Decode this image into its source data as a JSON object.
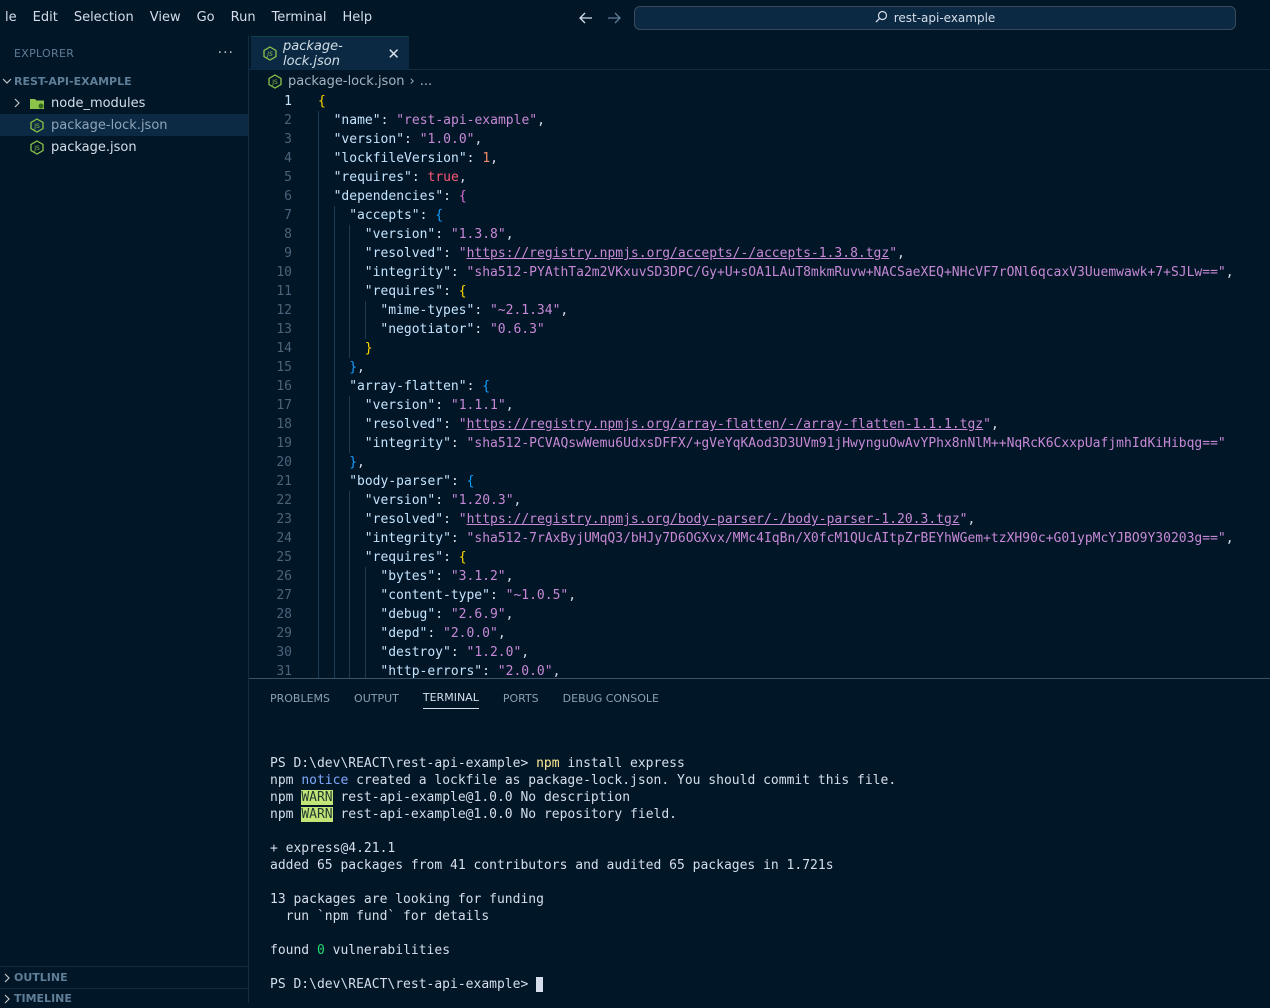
{
  "menu": [
    "le",
    "Edit",
    "Selection",
    "View",
    "Go",
    "Run",
    "Terminal",
    "Help"
  ],
  "search": {
    "label": "rest-api-example"
  },
  "sidebar": {
    "explorer_title": "EXPLORER",
    "explorer_more": "···",
    "project": "REST-API-EXAMPLE",
    "items": [
      {
        "label": "node_modules",
        "icon": "folder-icon"
      },
      {
        "label": "package-lock.json",
        "icon": "nodejs-icon"
      },
      {
        "label": "package.json",
        "icon": "nodejs-icon"
      }
    ],
    "outline": "OUTLINE",
    "timeline": "TIMELINE"
  },
  "tab": {
    "label": "package-lock.json",
    "close": "✕"
  },
  "breadcrumb": {
    "file": "package-lock.json",
    "sep": "›",
    "rest": "..."
  },
  "editor_lines": [
    [
      [
        "br1",
        "{"
      ]
    ],
    [
      [
        "k",
        "\"name\""
      ],
      [
        "p",
        ": "
      ],
      [
        "s",
        "\"rest-api-example\""
      ],
      [
        "p",
        ","
      ]
    ],
    [
      [
        "k",
        "\"version\""
      ],
      [
        "p",
        ": "
      ],
      [
        "s",
        "\"1.0.0\""
      ],
      [
        "p",
        ","
      ]
    ],
    [
      [
        "k",
        "\"lockfileVersion\""
      ],
      [
        "p",
        ": "
      ],
      [
        "num",
        "1"
      ],
      [
        "p",
        ","
      ]
    ],
    [
      [
        "k",
        "\"requires\""
      ],
      [
        "p",
        ": "
      ],
      [
        "b",
        "true"
      ],
      [
        "p",
        ","
      ]
    ],
    [
      [
        "k",
        "\"dependencies\""
      ],
      [
        "p",
        ": "
      ],
      [
        "br2",
        "{"
      ]
    ],
    [
      [
        "k",
        "\"accepts\""
      ],
      [
        "p",
        ": "
      ],
      [
        "br3",
        "{"
      ]
    ],
    [
      [
        "k",
        "\"version\""
      ],
      [
        "p",
        ": "
      ],
      [
        "s",
        "\"1.3.8\""
      ],
      [
        "p",
        ","
      ]
    ],
    [
      [
        "k",
        "\"resolved\""
      ],
      [
        "p",
        ": "
      ],
      [
        "s",
        "\""
      ],
      [
        "su",
        "https://registry.npmjs.org/accepts/-/accepts-1.3.8.tgz"
      ],
      [
        "s",
        "\""
      ],
      [
        "p",
        ","
      ]
    ],
    [
      [
        "k",
        "\"integrity\""
      ],
      [
        "p",
        ": "
      ],
      [
        "s",
        "\"sha512-PYAthTa2m2VKxuvSD3DPC/Gy+U+sOA1LAuT8mkmRuvw+NACSaeXEQ+NHcVF7rONl6qcaxV3Uuemwawk+7+SJLw==\""
      ],
      [
        "p",
        ","
      ]
    ],
    [
      [
        "k",
        "\"requires\""
      ],
      [
        "p",
        ": "
      ],
      [
        "br1",
        "{"
      ]
    ],
    [
      [
        "k",
        "\"mime-types\""
      ],
      [
        "p",
        ": "
      ],
      [
        "s",
        "\"~2.1.34\""
      ],
      [
        "p",
        ","
      ]
    ],
    [
      [
        "k",
        "\"negotiator\""
      ],
      [
        "p",
        ": "
      ],
      [
        "s",
        "\"0.6.3\""
      ]
    ],
    [
      [
        "br1",
        "}"
      ]
    ],
    [
      [
        "br3",
        "}"
      ],
      [
        "p",
        ","
      ]
    ],
    [
      [
        "k",
        "\"array-flatten\""
      ],
      [
        "p",
        ": "
      ],
      [
        "br3",
        "{"
      ]
    ],
    [
      [
        "k",
        "\"version\""
      ],
      [
        "p",
        ": "
      ],
      [
        "s",
        "\"1.1.1\""
      ],
      [
        "p",
        ","
      ]
    ],
    [
      [
        "k",
        "\"resolved\""
      ],
      [
        "p",
        ": "
      ],
      [
        "s",
        "\""
      ],
      [
        "su",
        "https://registry.npmjs.org/array-flatten/-/array-flatten-1.1.1.tgz"
      ],
      [
        "s",
        "\""
      ],
      [
        "p",
        ","
      ]
    ],
    [
      [
        "k",
        "\"integrity\""
      ],
      [
        "p",
        ": "
      ],
      [
        "s",
        "\"sha512-PCVAQswWemu6UdxsDFFX/+gVeYqKAod3D3UVm91jHwynguOwAvYPhx8nNlM++NqRcK6CxxpUafjmhIdKiHibqg==\""
      ]
    ],
    [
      [
        "br3",
        "}"
      ],
      [
        "p",
        ","
      ]
    ],
    [
      [
        "k",
        "\"body-parser\""
      ],
      [
        "p",
        ": "
      ],
      [
        "br3",
        "{"
      ]
    ],
    [
      [
        "k",
        "\"version\""
      ],
      [
        "p",
        ": "
      ],
      [
        "s",
        "\"1.20.3\""
      ],
      [
        "p",
        ","
      ]
    ],
    [
      [
        "k",
        "\"resolved\""
      ],
      [
        "p",
        ": "
      ],
      [
        "s",
        "\""
      ],
      [
        "su",
        "https://registry.npmjs.org/body-parser/-/body-parser-1.20.3.tgz"
      ],
      [
        "s",
        "\""
      ],
      [
        "p",
        ","
      ]
    ],
    [
      [
        "k",
        "\"integrity\""
      ],
      [
        "p",
        ": "
      ],
      [
        "s",
        "\"sha512-7rAxByjUMqQ3/bHJy7D6OGXvx/MMc4IqBn/X0fcM1QUcAItpZrBEYhWGem+tzXH90c+G01ypMcYJBO9Y30203g==\""
      ],
      [
        "p",
        ","
      ]
    ],
    [
      [
        "k",
        "\"requires\""
      ],
      [
        "p",
        ": "
      ],
      [
        "br1",
        "{"
      ]
    ],
    [
      [
        "k",
        "\"bytes\""
      ],
      [
        "p",
        ": "
      ],
      [
        "s",
        "\"3.1.2\""
      ],
      [
        "p",
        ","
      ]
    ],
    [
      [
        "k",
        "\"content-type\""
      ],
      [
        "p",
        ": "
      ],
      [
        "s",
        "\"~1.0.5\""
      ],
      [
        "p",
        ","
      ]
    ],
    [
      [
        "k",
        "\"debug\""
      ],
      [
        "p",
        ": "
      ],
      [
        "s",
        "\"2.6.9\""
      ],
      [
        "p",
        ","
      ]
    ],
    [
      [
        "k",
        "\"depd\""
      ],
      [
        "p",
        ": "
      ],
      [
        "s",
        "\"2.0.0\""
      ],
      [
        "p",
        ","
      ]
    ],
    [
      [
        "k",
        "\"destroy\""
      ],
      [
        "p",
        ": "
      ],
      [
        "s",
        "\"1.2.0\""
      ],
      [
        "p",
        ","
      ]
    ],
    [
      [
        "k",
        "\"http-errors\""
      ],
      [
        "p",
        ": "
      ],
      [
        "s",
        "\"2.0.0\""
      ],
      [
        "p",
        ","
      ]
    ]
  ],
  "editor_indents": [
    0,
    1,
    1,
    1,
    1,
    1,
    2,
    3,
    3,
    3,
    3,
    4,
    4,
    3,
    2,
    2,
    3,
    3,
    3,
    2,
    2,
    3,
    3,
    3,
    3,
    4,
    4,
    4,
    4,
    4,
    4
  ],
  "panel_tabs": [
    "PROBLEMS",
    "OUTPUT",
    "TERMINAL",
    "PORTS",
    "DEBUG CONSOLE"
  ],
  "terminal_lines": [
    [
      [
        "p",
        "PS D:\\dev\\REACT\\rest-api-example> "
      ],
      [
        "cmd",
        "npm"
      ],
      [
        "p",
        " install express"
      ]
    ],
    [
      [
        "p",
        "npm "
      ],
      [
        "notice",
        "notice"
      ],
      [
        "p",
        " created a lockfile as package-lock.json. You should commit this file."
      ]
    ],
    [
      [
        "p",
        "npm "
      ],
      [
        "warn",
        "WARN"
      ],
      [
        "p",
        " rest-api-example@1.0.0 No description"
      ]
    ],
    [
      [
        "p",
        "npm "
      ],
      [
        "warn",
        "WARN"
      ],
      [
        "p",
        " rest-api-example@1.0.0 No repository field."
      ]
    ],
    [
      [
        "p",
        ""
      ]
    ],
    [
      [
        "p",
        "+ express@4.21.1"
      ]
    ],
    [
      [
        "p",
        "added 65 packages from 41 contributors and audited 65 packages in 1.721s"
      ]
    ],
    [
      [
        "p",
        ""
      ]
    ],
    [
      [
        "p",
        "13 packages are looking for funding"
      ]
    ],
    [
      [
        "p",
        "  run `npm fund` for details"
      ]
    ],
    [
      [
        "p",
        ""
      ]
    ],
    [
      [
        "p",
        "found "
      ],
      [
        "green",
        "0"
      ],
      [
        "p",
        " vulnerabilities"
      ]
    ],
    [
      [
        "p",
        ""
      ]
    ],
    [
      [
        "p",
        "PS D:\\dev\\REACT\\rest-api-example> "
      ],
      [
        "cursor",
        ""
      ]
    ]
  ]
}
